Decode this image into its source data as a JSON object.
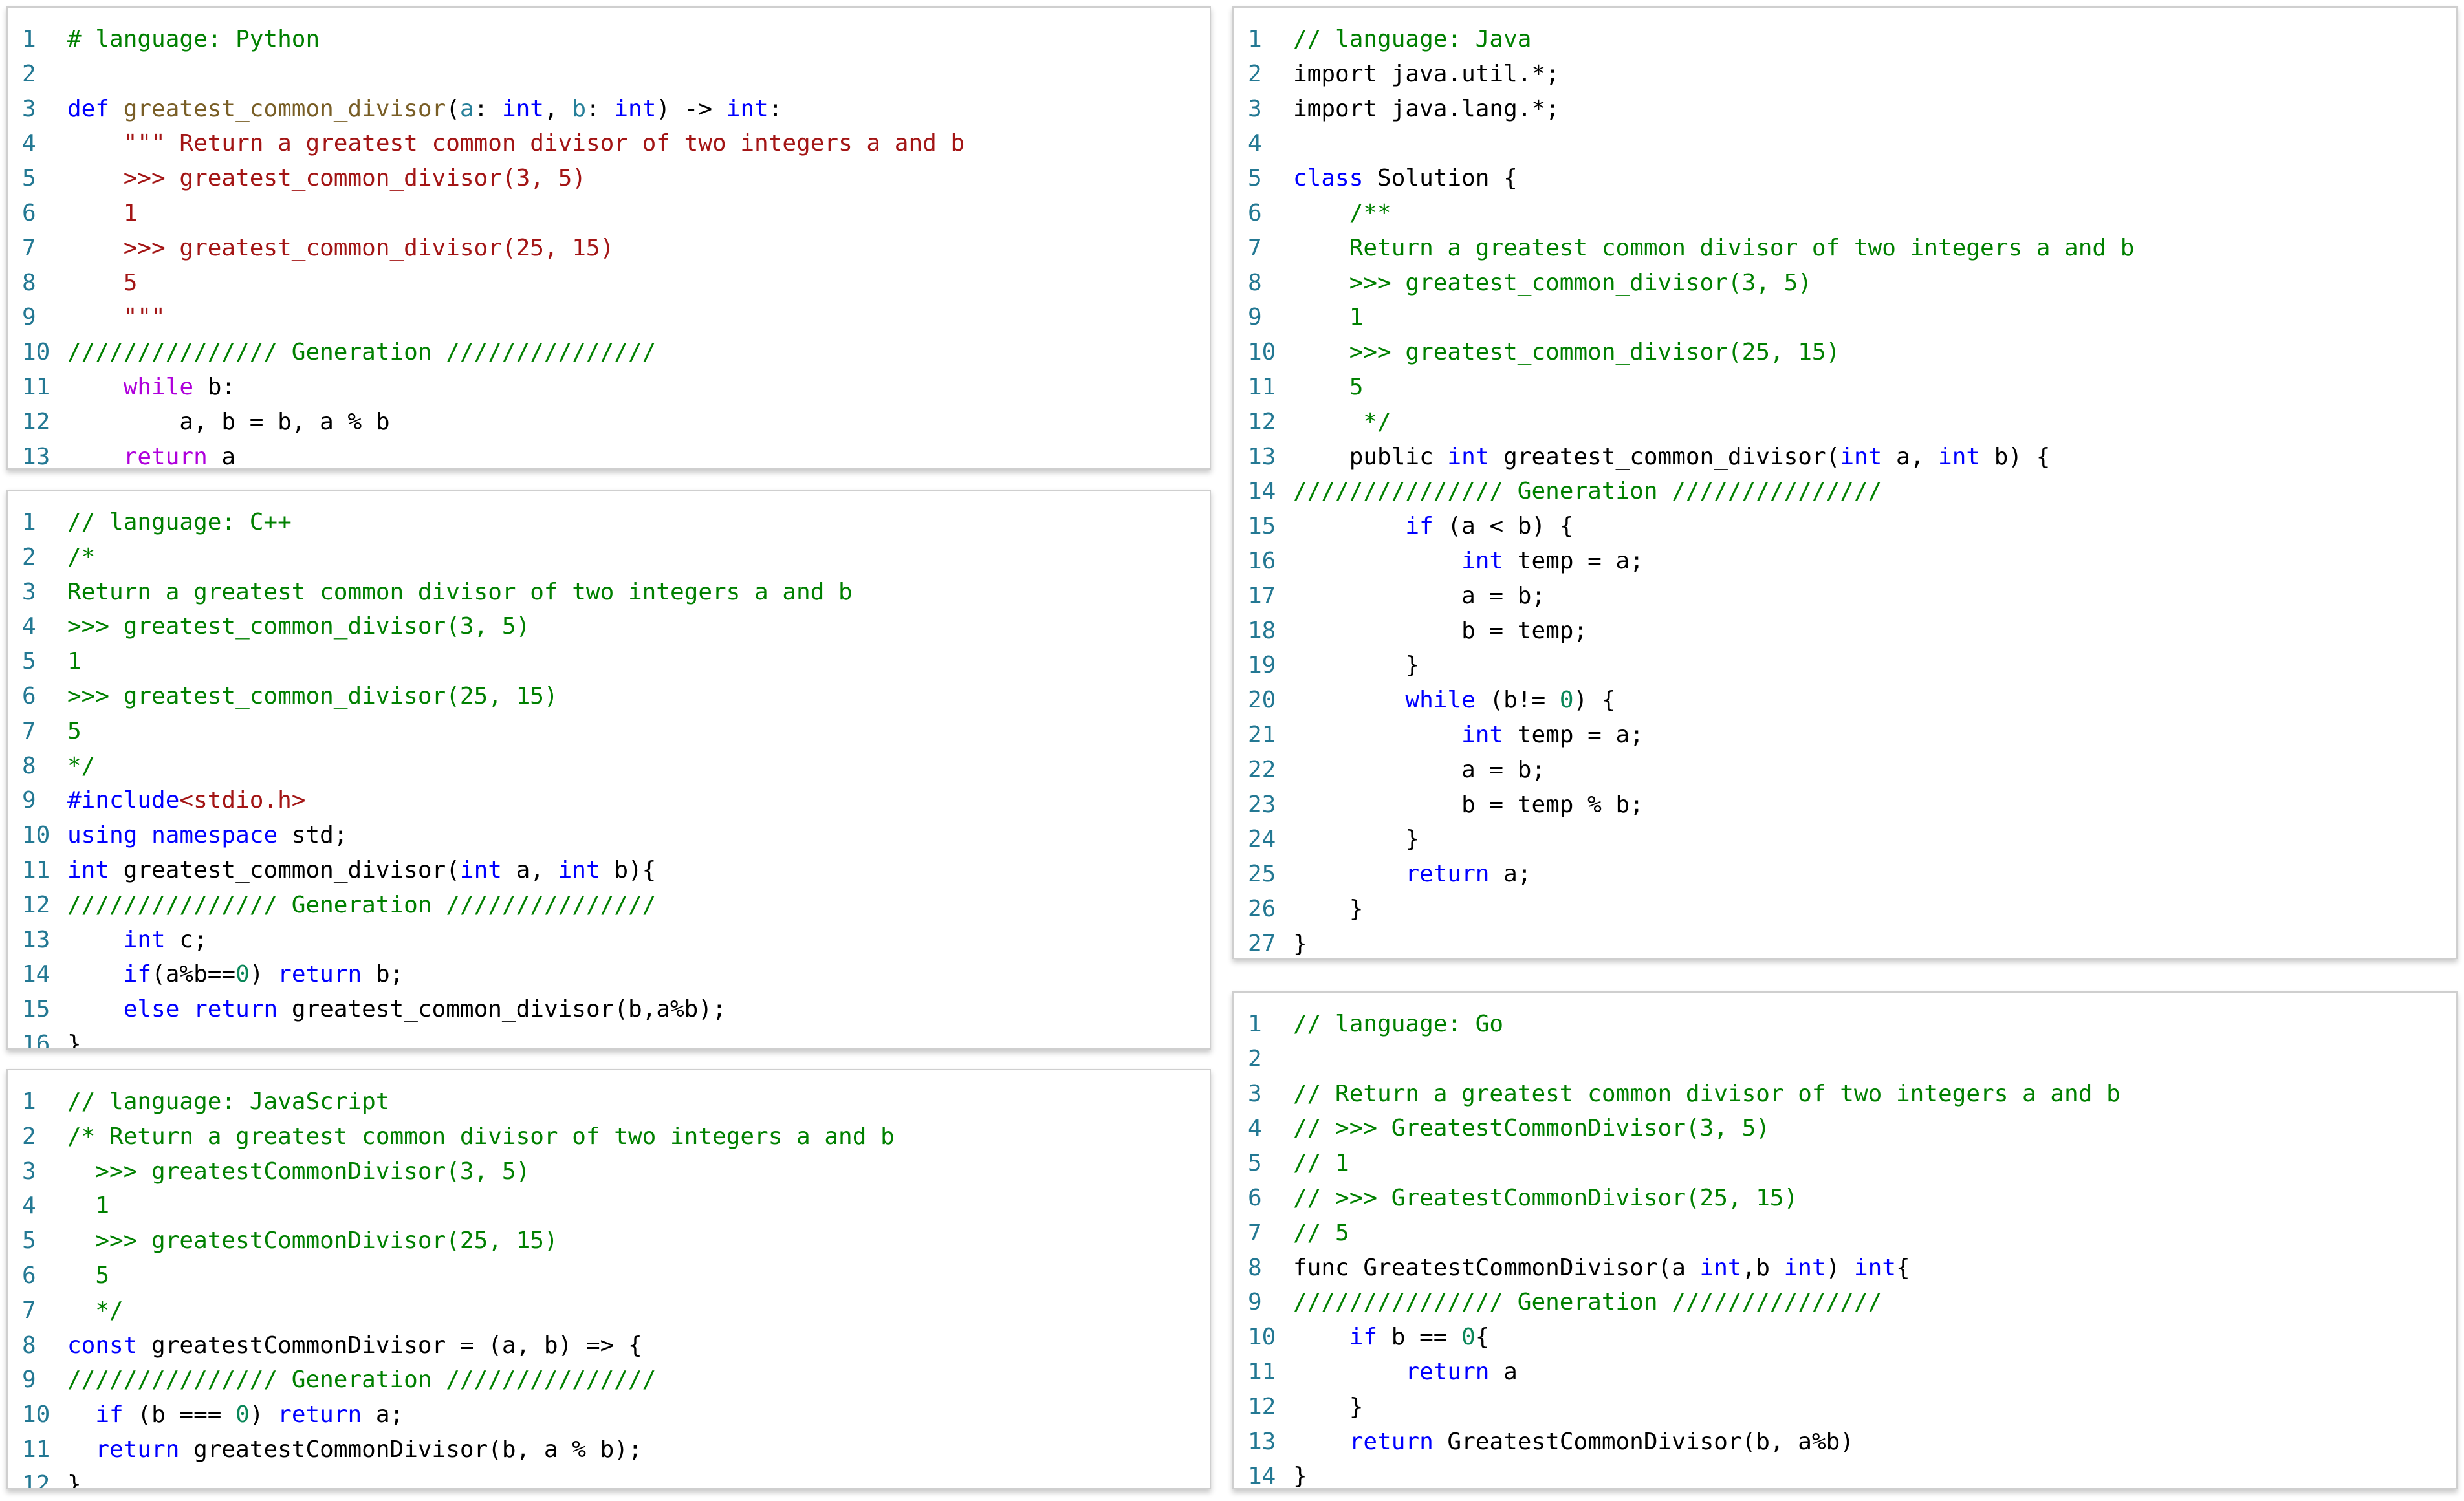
{
  "panels": [
    {
      "id": "python",
      "language": "Python",
      "lines": [
        [
          [
            "c",
            "# language: Python"
          ]
        ],
        [],
        [
          [
            "k",
            "def "
          ],
          [
            "f",
            "greatest_common_divisor"
          ],
          [
            "p",
            "("
          ],
          [
            "v",
            "a"
          ],
          [
            "p",
            ": "
          ],
          [
            "t",
            "int"
          ],
          [
            "p",
            ", "
          ],
          [
            "v",
            "b"
          ],
          [
            "p",
            ": "
          ],
          [
            "t",
            "int"
          ],
          [
            "p",
            ") -> "
          ],
          [
            "t",
            "int"
          ],
          [
            "p",
            ":"
          ]
        ],
        [
          [
            "p",
            "    "
          ],
          [
            "s",
            "\"\"\" Return a greatest common divisor of two integers a and b"
          ]
        ],
        [
          [
            "s",
            "    >>> greatest_common_divisor(3, 5)"
          ]
        ],
        [
          [
            "s",
            "    1"
          ]
        ],
        [
          [
            "s",
            "    >>> greatest_common_divisor(25, 15)"
          ]
        ],
        [
          [
            "s",
            "    5"
          ]
        ],
        [
          [
            "s",
            "    \"\"\""
          ]
        ],
        [
          [
            "c",
            "/////////////// Generation ///////////////"
          ]
        ],
        [
          [
            "p",
            "    "
          ],
          [
            "x",
            "while"
          ],
          [
            "p",
            " b:"
          ]
        ],
        [
          [
            "p",
            "        a, b = b, a % b"
          ]
        ],
        [
          [
            "p",
            "    "
          ],
          [
            "x",
            "return"
          ],
          [
            "p",
            " a"
          ]
        ]
      ]
    },
    {
      "id": "cpp",
      "language": "C++",
      "lines": [
        [
          [
            "c",
            "// language: C++"
          ]
        ],
        [
          [
            "c",
            "/*"
          ]
        ],
        [
          [
            "c",
            "Return a greatest common divisor of two integers a and b"
          ]
        ],
        [
          [
            "c",
            ">>> greatest_common_divisor(3, 5)"
          ]
        ],
        [
          [
            "c",
            "1"
          ]
        ],
        [
          [
            "c",
            ">>> greatest_common_divisor(25, 15)"
          ]
        ],
        [
          [
            "c",
            "5"
          ]
        ],
        [
          [
            "c",
            "*/"
          ]
        ],
        [
          [
            "k",
            "#include"
          ],
          [
            "s",
            "<stdio.h>"
          ]
        ],
        [
          [
            "k",
            "using"
          ],
          [
            "p",
            " "
          ],
          [
            "k",
            "namespace"
          ],
          [
            "p",
            " std;"
          ]
        ],
        [
          [
            "t",
            "int"
          ],
          [
            "p",
            " greatest_common_divisor("
          ],
          [
            "t",
            "int"
          ],
          [
            "p",
            " a, "
          ],
          [
            "t",
            "int"
          ],
          [
            "p",
            " b){"
          ]
        ],
        [
          [
            "c",
            "/////////////// Generation ///////////////"
          ]
        ],
        [
          [
            "p",
            "    "
          ],
          [
            "t",
            "int"
          ],
          [
            "p",
            " c;"
          ]
        ],
        [
          [
            "p",
            "    "
          ],
          [
            "k",
            "if"
          ],
          [
            "p",
            "(a%b=="
          ],
          [
            "n",
            "0"
          ],
          [
            "p",
            ") "
          ],
          [
            "k",
            "return"
          ],
          [
            "p",
            " b;"
          ]
        ],
        [
          [
            "p",
            "    "
          ],
          [
            "k",
            "else"
          ],
          [
            "p",
            " "
          ],
          [
            "k",
            "return"
          ],
          [
            "p",
            " greatest_common_divisor(b,a%b);"
          ]
        ],
        [
          [
            "p",
            "}"
          ]
        ]
      ]
    },
    {
      "id": "javascript",
      "language": "JavaScript",
      "lines": [
        [
          [
            "c",
            "// language: JavaScript"
          ]
        ],
        [
          [
            "c",
            "/* Return a greatest common divisor of two integers a and b"
          ]
        ],
        [
          [
            "c",
            "  >>> greatestCommonDivisor(3, 5)"
          ]
        ],
        [
          [
            "c",
            "  1"
          ]
        ],
        [
          [
            "c",
            "  >>> greatestCommonDivisor(25, 15)"
          ]
        ],
        [
          [
            "c",
            "  5"
          ]
        ],
        [
          [
            "c",
            "  */"
          ]
        ],
        [
          [
            "k",
            "const"
          ],
          [
            "p",
            " greatestCommonDivisor = (a, b) => {"
          ]
        ],
        [
          [
            "c",
            "/////////////// Generation ///////////////"
          ]
        ],
        [
          [
            "p",
            "  "
          ],
          [
            "k",
            "if"
          ],
          [
            "p",
            " (b === "
          ],
          [
            "n",
            "0"
          ],
          [
            "p",
            ") "
          ],
          [
            "k",
            "return"
          ],
          [
            "p",
            " a;"
          ]
        ],
        [
          [
            "p",
            "  "
          ],
          [
            "k",
            "return"
          ],
          [
            "p",
            " greatestCommonDivisor(b, a % b);"
          ]
        ],
        [
          [
            "p",
            "}"
          ]
        ]
      ]
    },
    {
      "id": "java",
      "language": "Java",
      "lines": [
        [
          [
            "c",
            "// language: Java"
          ]
        ],
        [
          [
            "p",
            "import java.util.*;"
          ]
        ],
        [
          [
            "p",
            "import java.lang.*;"
          ]
        ],
        [],
        [
          [
            "k",
            "class"
          ],
          [
            "p",
            " Solution {"
          ]
        ],
        [
          [
            "c",
            "    /**"
          ]
        ],
        [
          [
            "c",
            "    Return a greatest common divisor of two integers a and b"
          ]
        ],
        [
          [
            "c",
            "    >>> greatest_common_divisor(3, 5)"
          ]
        ],
        [
          [
            "c",
            "    1"
          ]
        ],
        [
          [
            "c",
            "    >>> greatest_common_divisor(25, 15)"
          ]
        ],
        [
          [
            "c",
            "    5"
          ]
        ],
        [
          [
            "c",
            "     */"
          ]
        ],
        [
          [
            "p",
            "    public "
          ],
          [
            "t",
            "int"
          ],
          [
            "p",
            " greatest_common_divisor("
          ],
          [
            "t",
            "int"
          ],
          [
            "p",
            " a, "
          ],
          [
            "t",
            "int"
          ],
          [
            "p",
            " b) {"
          ]
        ],
        [
          [
            "c",
            "/////////////// Generation ///////////////"
          ]
        ],
        [
          [
            "p",
            "        "
          ],
          [
            "k",
            "if"
          ],
          [
            "p",
            " (a < b) {"
          ]
        ],
        [
          [
            "p",
            "            "
          ],
          [
            "t",
            "int"
          ],
          [
            "p",
            " temp = a;"
          ]
        ],
        [
          [
            "p",
            "            a = b;"
          ]
        ],
        [
          [
            "p",
            "            b = temp;"
          ]
        ],
        [
          [
            "p",
            "        }"
          ]
        ],
        [
          [
            "p",
            "        "
          ],
          [
            "k",
            "while"
          ],
          [
            "p",
            " (b!= "
          ],
          [
            "n",
            "0"
          ],
          [
            "p",
            ") {"
          ]
        ],
        [
          [
            "p",
            "            "
          ],
          [
            "t",
            "int"
          ],
          [
            "p",
            " temp = a;"
          ]
        ],
        [
          [
            "p",
            "            a = b;"
          ]
        ],
        [
          [
            "p",
            "            b = temp % b;"
          ]
        ],
        [
          [
            "p",
            "        }"
          ]
        ],
        [
          [
            "p",
            "        "
          ],
          [
            "k",
            "return"
          ],
          [
            "p",
            " a;"
          ]
        ],
        [
          [
            "p",
            "    }"
          ]
        ],
        [
          [
            "p",
            "}"
          ]
        ]
      ]
    },
    {
      "id": "go",
      "language": "Go",
      "lines": [
        [
          [
            "c",
            "// language: Go"
          ]
        ],
        [],
        [
          [
            "c",
            "// Return a greatest common divisor of two integers a and b"
          ]
        ],
        [
          [
            "c",
            "// >>> GreatestCommonDivisor(3, 5)"
          ]
        ],
        [
          [
            "c",
            "// 1"
          ]
        ],
        [
          [
            "c",
            "// >>> GreatestCommonDivisor(25, 15)"
          ]
        ],
        [
          [
            "c",
            "// 5"
          ]
        ],
        [
          [
            "p",
            "func GreatestCommonDivisor(a "
          ],
          [
            "t",
            "int"
          ],
          [
            "p",
            ",b "
          ],
          [
            "t",
            "int"
          ],
          [
            "p",
            ") "
          ],
          [
            "t",
            "int"
          ],
          [
            "p",
            "{"
          ]
        ],
        [
          [
            "c",
            "/////////////// Generation ///////////////"
          ]
        ],
        [
          [
            "p",
            "    "
          ],
          [
            "k",
            "if"
          ],
          [
            "p",
            " b == "
          ],
          [
            "n",
            "0"
          ],
          [
            "p",
            "{"
          ]
        ],
        [
          [
            "p",
            "        "
          ],
          [
            "k",
            "return"
          ],
          [
            "p",
            " a"
          ]
        ],
        [
          [
            "p",
            "    }"
          ]
        ],
        [
          [
            "p",
            "    "
          ],
          [
            "k",
            "return"
          ],
          [
            "p",
            " GreatestCommonDivisor(b, a%b)"
          ]
        ],
        [
          [
            "p",
            "}"
          ]
        ]
      ]
    }
  ]
}
